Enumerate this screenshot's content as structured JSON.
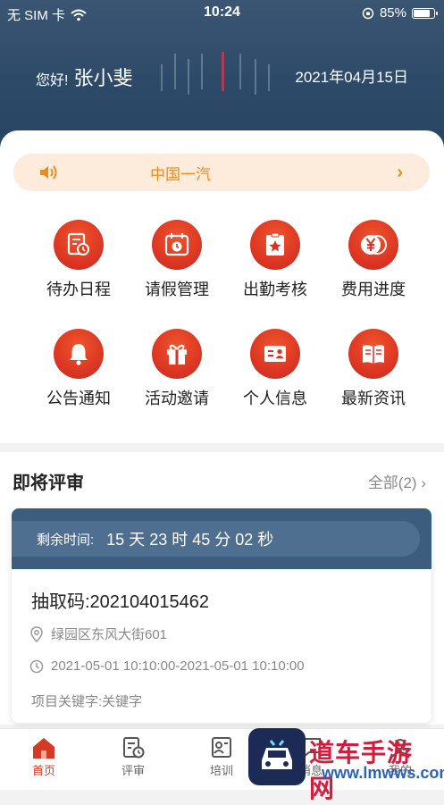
{
  "status_bar": {
    "carrier": "无 SIM 卡",
    "time": "10:24",
    "battery": "85%"
  },
  "header": {
    "greeting": "您好!",
    "user_name": "张小斐",
    "date": "2021年04月15日"
  },
  "notice": {
    "text": "中国一汽",
    "chevron": "›"
  },
  "grid_items": [
    {
      "label": "待办日程",
      "icon": "schedule-icon"
    },
    {
      "label": "请假管理",
      "icon": "calendar-clock-icon"
    },
    {
      "label": "出勤考核",
      "icon": "star-clipboard-icon"
    },
    {
      "label": "费用进度",
      "icon": "yen-coin-icon"
    },
    {
      "label": "公告通知",
      "icon": "bell-icon"
    },
    {
      "label": "活动邀请",
      "icon": "gift-icon"
    },
    {
      "label": "个人信息",
      "icon": "id-card-icon"
    },
    {
      "label": "最新资讯",
      "icon": "news-book-icon"
    }
  ],
  "review": {
    "title": "即将评审",
    "all_label": "全部(2)",
    "remaining_label": "剩余时间:",
    "remaining_value": "15 天 23 时 45 分 02 秒",
    "code": "抽取码:202104015462",
    "address": "绿园区东风大街601",
    "time_range": "2021-05-01 10:10:00-2021-05-01 10:10:00",
    "keywords": "项目关键字:关键字"
  },
  "tabs": [
    {
      "label": "首页",
      "icon": "home-icon",
      "active": true
    },
    {
      "label": "评审",
      "icon": "review-icon",
      "active": false
    },
    {
      "label": "培训",
      "icon": "training-icon",
      "active": false
    },
    {
      "label": "消息",
      "icon": "message-icon",
      "active": false
    },
    {
      "label": "我的",
      "icon": "profile-icon",
      "active": false
    }
  ],
  "watermark": {
    "title": "道车手游网",
    "url": "www.lmwws.com"
  },
  "colors": {
    "accent": "#d93222",
    "header": "#2d4a68",
    "notice_text": "#f08a1c",
    "notice_bg": "#fdecdc"
  }
}
